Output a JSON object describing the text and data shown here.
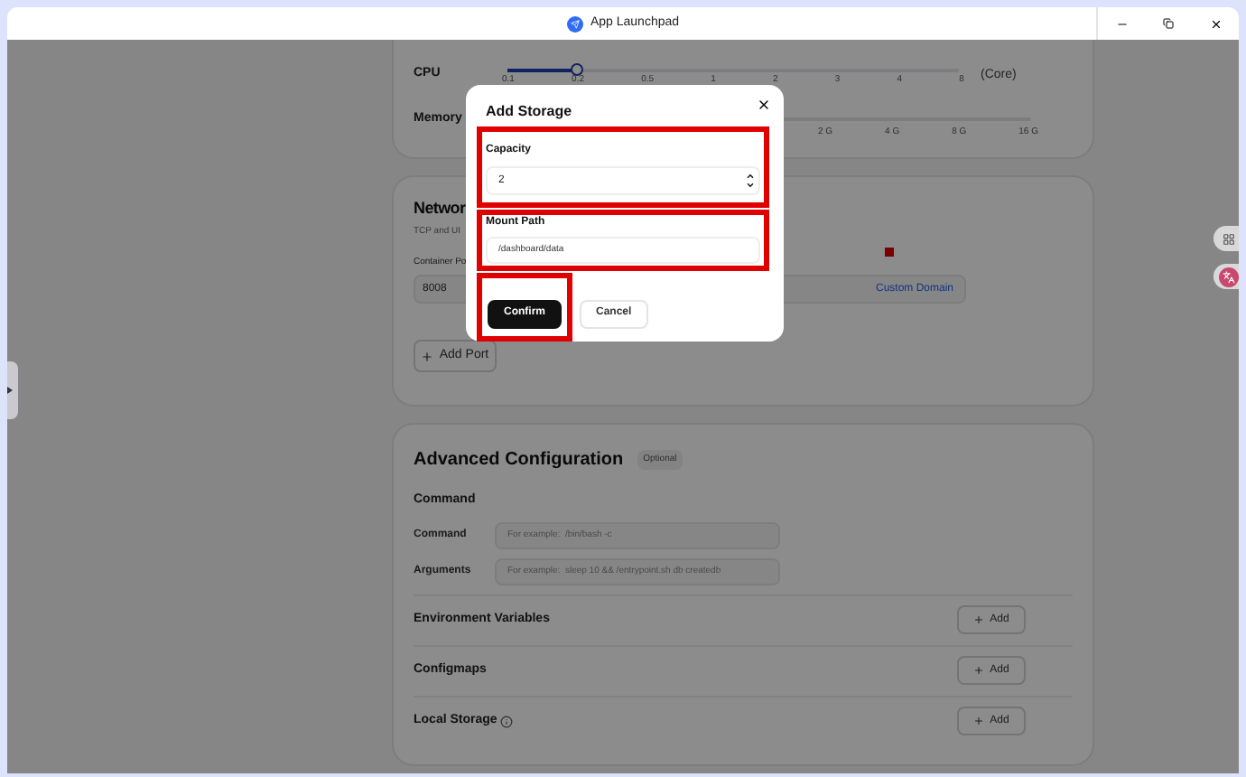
{
  "window": {
    "title": "App Launchpad"
  },
  "resources": {
    "cpu": {
      "label": "CPU",
      "level": 0.15,
      "ticks": [
        "0.1",
        "0.2",
        "0.5",
        "1",
        "2",
        "3",
        "4",
        "8"
      ],
      "unit": "(Core)"
    },
    "memory": {
      "label": "Memory",
      "ticks": [
        "2 G",
        "4 G",
        "8 G",
        "16 G"
      ]
    }
  },
  "network": {
    "title": "Networ",
    "subtitle": "TCP and UI",
    "port_label": "Container Po",
    "port_value": "8008",
    "link": "Custom Domain",
    "add_button": "Add Port",
    "marker": true
  },
  "advanced": {
    "title": "Advanced Configuration",
    "badge": "Optional",
    "command_heading": "Command",
    "fields": [
      {
        "label": "Command",
        "placeholder": "For example:  /bin/bash -c"
      },
      {
        "label": "Arguments",
        "placeholder": "For example:  sleep 10 && /entrypoint.sh db createdb"
      }
    ],
    "sections": [
      {
        "label": "Environment Variables",
        "button": "Add",
        "info": false
      },
      {
        "label": "Configmaps",
        "button": "Add",
        "info": false
      },
      {
        "label": "Local Storage",
        "button": "Add",
        "info": true
      }
    ]
  },
  "dialog": {
    "title": "Add Storage",
    "fields": [
      {
        "label": "Capacity",
        "value": "2",
        "kind": "number",
        "highlighted": true
      },
      {
        "label": "Mount Path",
        "value": "/dashboard/data",
        "kind": "text",
        "highlighted": true
      }
    ],
    "buttons": [
      {
        "label": "Confirm",
        "primary": true,
        "highlighted": true
      },
      {
        "label": "Cancel",
        "primary": false,
        "highlighted": false
      }
    ]
  }
}
